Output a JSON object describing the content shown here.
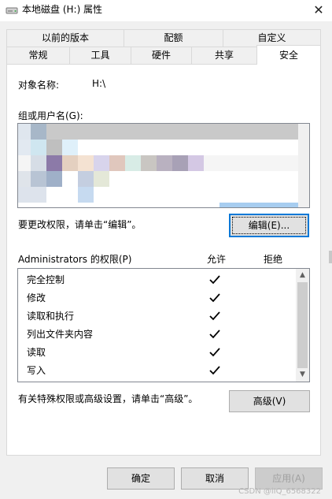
{
  "window": {
    "title": "本地磁盘 (H:) 属性",
    "close_glyph": "✕"
  },
  "tabs": {
    "row1": [
      "以前的版本",
      "配额",
      "自定义"
    ],
    "row2": [
      "常规",
      "工具",
      "硬件",
      "共享",
      "安全"
    ],
    "active": "安全"
  },
  "security": {
    "object_name_label": "对象名称:",
    "object_name_value": "H:\\",
    "group_label": "组或用户名(G):",
    "change_hint": "要更改权限，请单击“编辑”。",
    "edit_button": "编辑(E)...",
    "perm_header": "Administrators 的权限(P)",
    "col_allow": "允许",
    "col_deny": "拒绝",
    "permissions": [
      {
        "name": "完全控制",
        "allow": true,
        "deny": false
      },
      {
        "name": "修改",
        "allow": true,
        "deny": false
      },
      {
        "name": "读取和执行",
        "allow": true,
        "deny": false
      },
      {
        "name": "列出文件夹内容",
        "allow": true,
        "deny": false
      },
      {
        "name": "读取",
        "allow": true,
        "deny": false
      },
      {
        "name": "写入",
        "allow": true,
        "deny": false
      }
    ],
    "advanced_hint": "有关特殊权限或高级设置，请单击“高级”。",
    "advanced_button": "高级(V)"
  },
  "footer": {
    "ok": "确定",
    "cancel": "取消",
    "apply": "应用(A)"
  },
  "watermark": "CSDN @lIQ_6568322",
  "colors": {
    "accent": "#0078d7",
    "panel": "#ffffff",
    "background": "#f0f0f0"
  }
}
